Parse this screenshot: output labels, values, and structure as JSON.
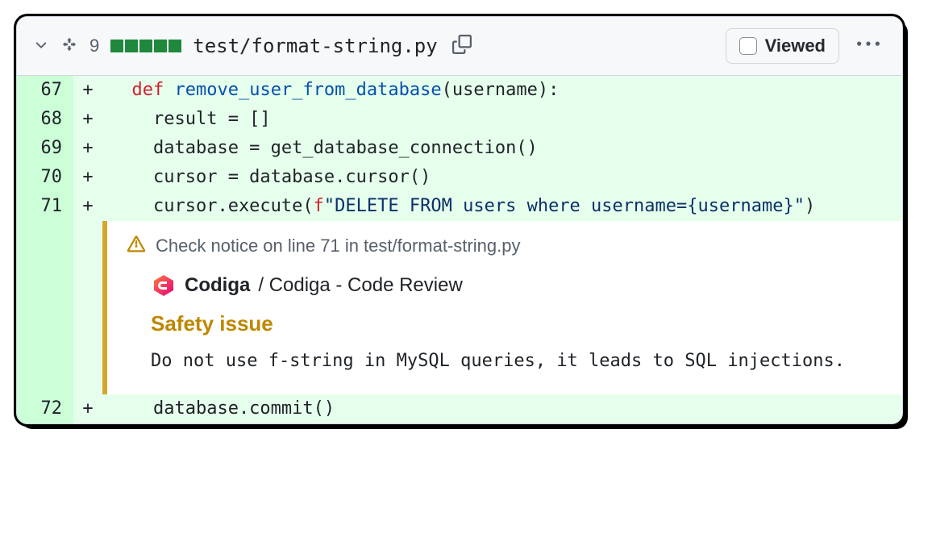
{
  "header": {
    "diff_count": "9",
    "filename": "test/format-string.py",
    "viewed_label": "Viewed"
  },
  "lines": {
    "0": {
      "n": "67",
      "m": "+",
      "indent": "  ",
      "kw": "def",
      "fn": "remove_user_from_database",
      "rest": "(username):"
    },
    "1": {
      "n": "68",
      "m": "+",
      "text": "    result = []"
    },
    "2": {
      "n": "69",
      "m": "+",
      "text": "    database = get_database_connection()"
    },
    "3": {
      "n": "70",
      "m": "+",
      "text": "    cursor = database.cursor()"
    },
    "4": {
      "n": "71",
      "m": "+",
      "pre": "    cursor.execute(",
      "kw2": "f",
      "str": "\"DELETE FROM users where username={username}\"",
      "post": ")"
    },
    "5": {
      "n": "72",
      "m": "+",
      "text": "    database.commit()"
    }
  },
  "annotation": {
    "notice": "Check notice on line 71 in test/format-string.py",
    "app_name": "Codiga",
    "reviewer": " / Codiga - Code Review",
    "title": "Safety issue",
    "message": "Do not use f-string in MySQL queries, it leads to SQL injections."
  }
}
